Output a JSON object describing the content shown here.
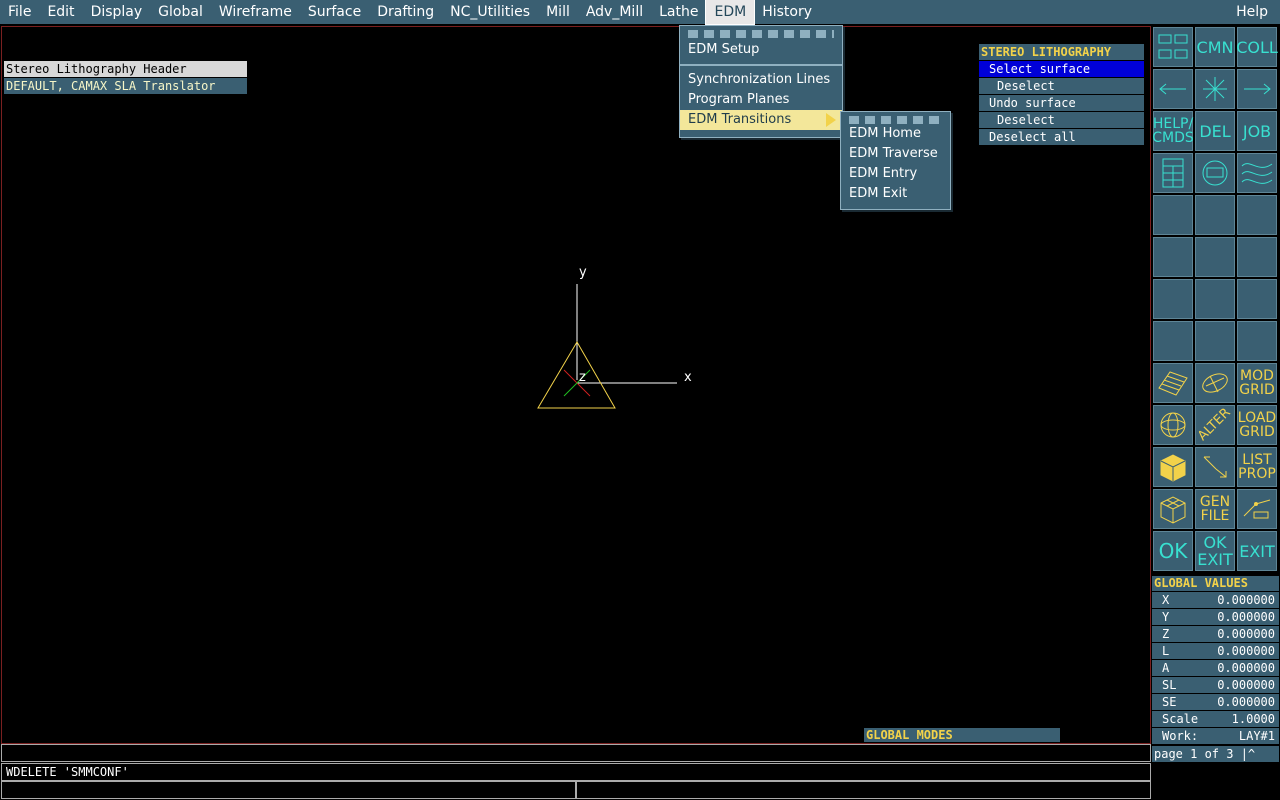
{
  "menubar": {
    "items": [
      "File",
      "Edit",
      "Display",
      "Global",
      "Wireframe",
      "Surface",
      "Drafting",
      "NC_Utilities",
      "Mill",
      "Adv_Mill",
      "Lathe",
      "EDM",
      "History"
    ],
    "help": "Help"
  },
  "headers": {
    "title": "Stereo Lithography Header",
    "value": "DEFAULT, CAMAX SLA Translator"
  },
  "edm_menu": {
    "setup": "EDM Setup",
    "sync": "Synchronization Lines",
    "planes": "Program Planes",
    "transitions": "EDM Transitions"
  },
  "transitions_menu": {
    "home": "EDM Home",
    "traverse": "EDM Traverse",
    "entry": "EDM Entry",
    "exit": "EDM Exit"
  },
  "stl_panel": {
    "title": "STEREO LITHOGRAPHY",
    "items": [
      "Select surface",
      "Deselect",
      "Undo surface",
      "Deselect",
      "Deselect all"
    ]
  },
  "axes": {
    "x": "x",
    "y": "y",
    "z": "z"
  },
  "palette": {
    "cmn": "CMN",
    "coll": "COLL",
    "help_cmds": "HELP/\nCMDS",
    "del": "DEL",
    "job": "JOB",
    "mod_grid": "MOD\nGRID",
    "alter": "ALTER",
    "load_grid": "LOAD\nGRID",
    "list_prop": "LIST\nPROP",
    "gen_file": "GEN\nFILE",
    "ok": "OK",
    "ok_exit": "OK\nEXIT",
    "exit": "EXIT"
  },
  "global_values": {
    "title": "GLOBAL VALUES",
    "rows": [
      {
        "k": "X",
        "v": "0.000000"
      },
      {
        "k": "Y",
        "v": "0.000000"
      },
      {
        "k": "Z",
        "v": "0.000000"
      },
      {
        "k": "L",
        "v": "0.000000"
      },
      {
        "k": "A",
        "v": "0.000000"
      },
      {
        "k": "SL",
        "v": "0.000000"
      },
      {
        "k": "SE",
        "v": "0.000000"
      },
      {
        "k": "Scale",
        "v": "1.0000"
      },
      {
        "k": "Work:",
        "v": "LAY#1"
      }
    ],
    "page": "page 1 of 3 |^"
  },
  "global_modes": "GLOBAL MODES",
  "command_line": "WDELETE 'SMMCONF'",
  "colors": {
    "panel": "#3a5f72",
    "accent": "#f2d24a",
    "select": "#0000d8"
  }
}
